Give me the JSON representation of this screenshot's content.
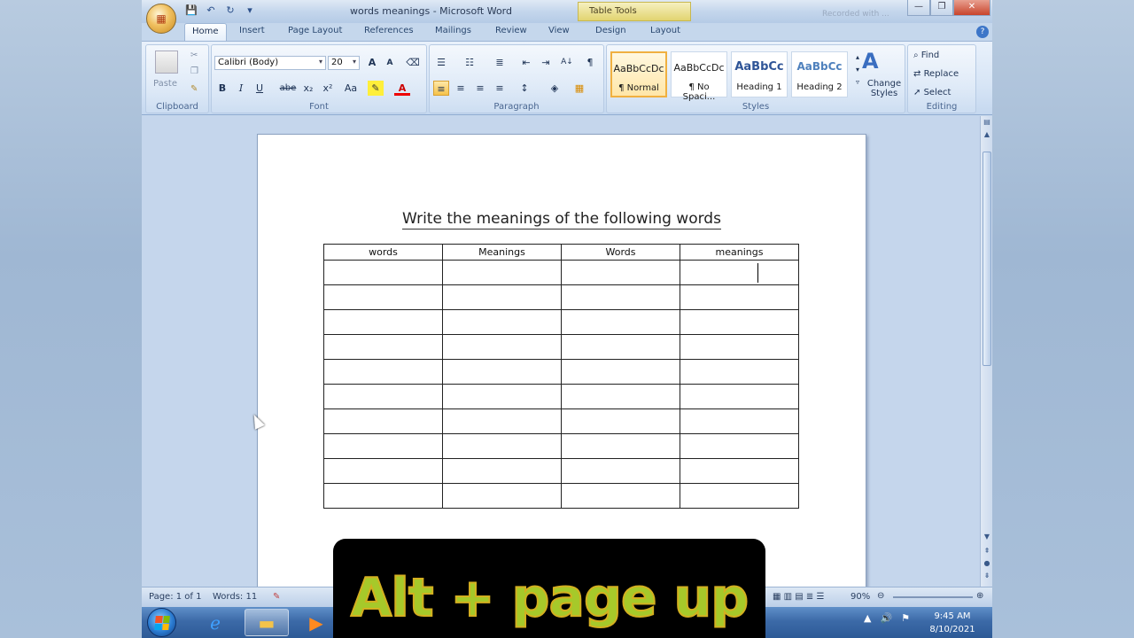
{
  "window": {
    "title": "words meanings - Microsoft Word",
    "context_tab": "Table Tools",
    "recorder_note": "Recorded with ...",
    "controls": {
      "minimize": "—",
      "maximize": "❐",
      "close": "✕"
    }
  },
  "qat": {
    "save": "💾",
    "undo": "↶",
    "redo": "↻",
    "more": "▾"
  },
  "tabs": [
    "Home",
    "Insert",
    "Page Layout",
    "References",
    "Mailings",
    "Review",
    "View",
    "Design",
    "Layout"
  ],
  "ribbon": {
    "clipboard": {
      "label": "Clipboard",
      "paste": "Paste"
    },
    "font": {
      "label": "Font",
      "font_name": "Calibri (Body)",
      "font_size": "20",
      "bold": "B",
      "italic": "I",
      "underline": "U",
      "strike": "abe",
      "subscript": "x₂",
      "superscript": "x²",
      "change_case": "Aa",
      "grow": "A",
      "shrink": "A"
    },
    "paragraph": {
      "label": "Paragraph",
      "show_marks": "¶",
      "sort": "A↓"
    },
    "styles": {
      "label": "Styles",
      "items": [
        {
          "sample": "AaBbCcDc",
          "name": "¶ Normal"
        },
        {
          "sample": "AaBbCcDc",
          "name": "¶ No Spaci..."
        },
        {
          "sample": "AaBbCc",
          "name": "Heading 1"
        },
        {
          "sample": "AaBbCc",
          "name": "Heading 2"
        }
      ],
      "change_styles": "Change Styles"
    },
    "editing": {
      "label": "Editing",
      "find": "Find",
      "replace": "Replace",
      "select": "Select"
    }
  },
  "document": {
    "title": "Write  the meanings of the following words",
    "table_headers": [
      "words",
      "Meanings",
      "Words",
      "meanings"
    ],
    "empty_rows": 10
  },
  "statusbar": {
    "page": "Page: 1 of 1",
    "words": "Words: 11",
    "zoom": "90%"
  },
  "taskbar": {
    "time": "9:45 AM",
    "date": "8/10/2021"
  },
  "caption": "Alt + page up"
}
